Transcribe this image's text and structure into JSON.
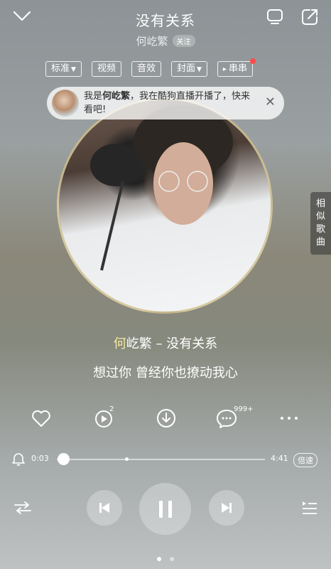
{
  "header": {
    "title": "没有关系",
    "artist": "何屹繁",
    "follow_label": "关注"
  },
  "tabs": [
    {
      "label": "标准",
      "dropdown": true
    },
    {
      "label": "视频",
      "dropdown": false
    },
    {
      "label": "音效",
      "dropdown": false
    },
    {
      "label": "封面",
      "dropdown": true
    },
    {
      "label": "串串",
      "dropdown": false,
      "play_glyph": "▸",
      "has_red_dot": true
    }
  ],
  "notice": {
    "prefix": "我是",
    "name": "何屹繁",
    "suffix": "，我在酷狗直播开播了，快来看吧!"
  },
  "similar_songs": [
    "相",
    "似",
    "歌",
    "曲"
  ],
  "lyrics": {
    "song_artist_first": "何",
    "song_artist_rest": "屹繁",
    "song_separator": " – ",
    "song_title": "没有关系",
    "current_line": "想过你 曾经你也撩动我心"
  },
  "actions": {
    "repeat_count": "2",
    "comment_count": "999+"
  },
  "progress": {
    "current": "0:03",
    "total": "4:41",
    "fraction": 0.011,
    "speed_label": "倍速"
  },
  "pager": {
    "count": 2,
    "active": 0
  },
  "colors": {
    "lyric_highlight": "#f3e9a0",
    "red_dot": "#ff4b4b"
  }
}
